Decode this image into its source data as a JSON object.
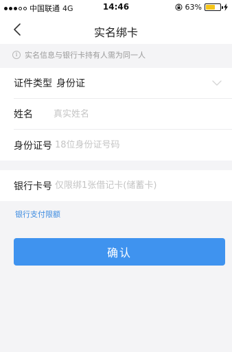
{
  "status_bar": {
    "carrier": "中国联通",
    "network": "4G",
    "time": "14:46",
    "battery_percent": "63%",
    "battery_level": 0.63
  },
  "nav": {
    "title": "实名绑卡"
  },
  "notice": {
    "text": "实名信息与银行卡持有人需为同一人"
  },
  "form": {
    "id_type_label": "证件类型",
    "id_type_value": "身份证",
    "name_label": "姓名",
    "name_placeholder": "真实姓名",
    "id_number_label": "身份证号",
    "id_number_placeholder": "18位身份证号码"
  },
  "bank": {
    "card_label": "银行卡号",
    "card_placeholder": "仅限绑1张借记卡(储蓄卡)"
  },
  "limit_link": "银行支付限额",
  "confirm_label": "确认",
  "colors": {
    "accent": "#3f93ef",
    "link": "#3d8be0",
    "background": "#f4f4f6"
  }
}
